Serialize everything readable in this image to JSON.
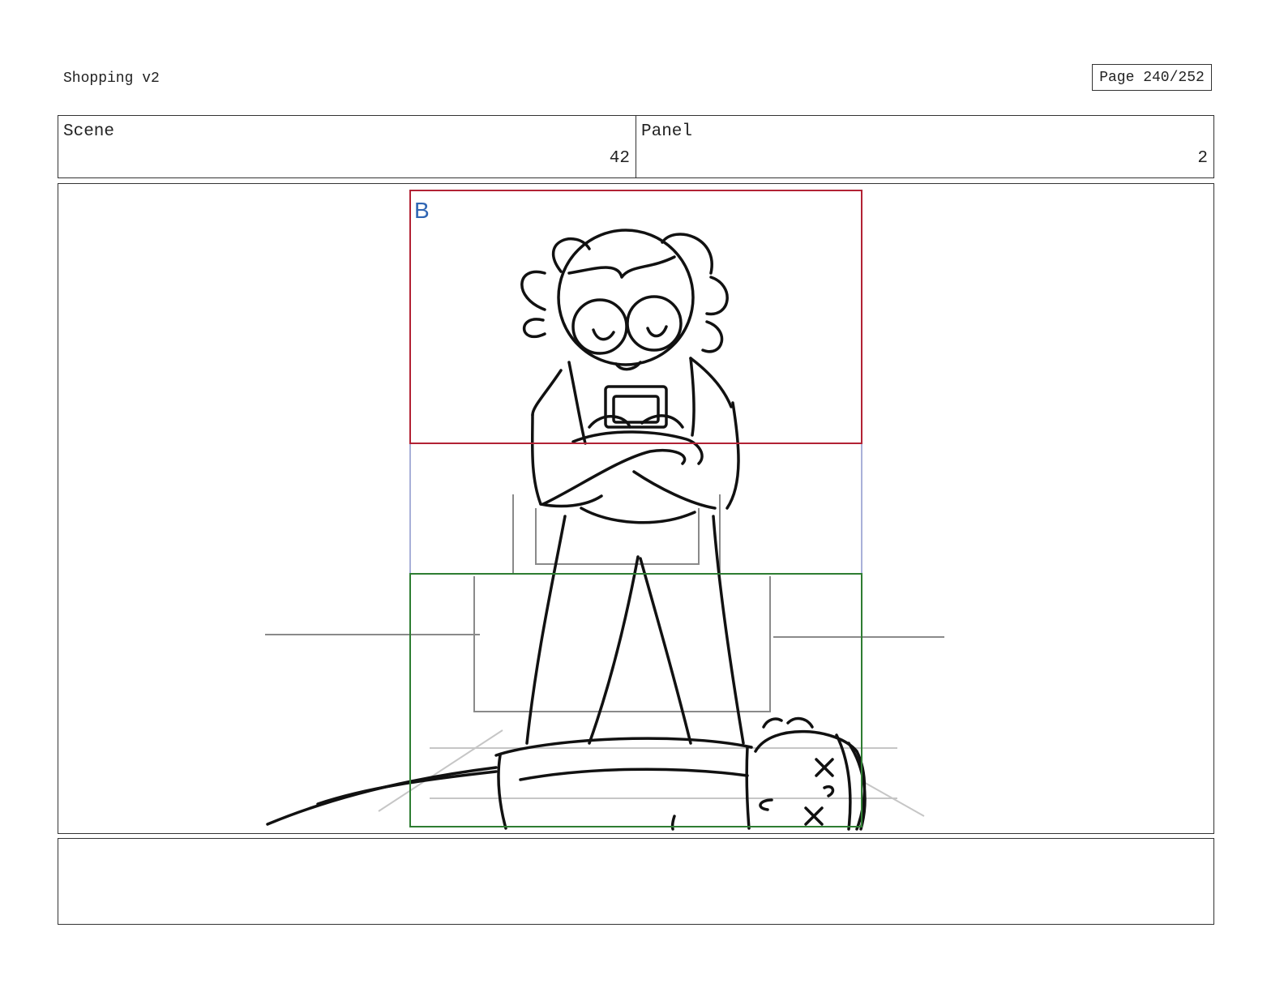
{
  "header": {
    "project_title": "Shopping v2",
    "page_indicator": "Page 240/252"
  },
  "info": {
    "scene_label": "Scene",
    "scene_value": "42",
    "panel_label": "Panel",
    "panel_value": "2"
  },
  "frame": {
    "camera_label": "B",
    "colors": {
      "camera_frame_b": "#b22234",
      "lower_frame": "#2e7d32",
      "guide": "#8c96cc",
      "label": "#2f65b3"
    },
    "drawing": "storyboard sketch"
  },
  "notes": {
    "text": ""
  }
}
